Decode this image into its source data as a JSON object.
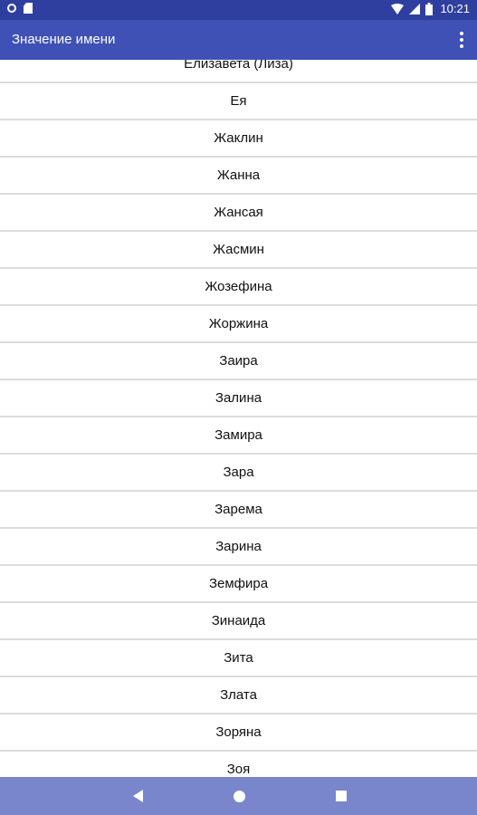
{
  "status_bar": {
    "time": "10:21",
    "icons": [
      "sync-circle-icon",
      "sd-card-icon",
      "wifi-icon",
      "signal-icon",
      "battery-icon"
    ]
  },
  "app_bar": {
    "title": "Значение имени",
    "menu_icon": "overflow-menu-icon"
  },
  "names": [
    "Елизавета (Лиза)",
    "Ея",
    "Жаклин",
    "Жанна",
    "Жансая",
    "Жасмин",
    "Жозефина",
    "Жоржина",
    "Заира",
    "Залина",
    "Замира",
    "Зара",
    "Зарема",
    "Зарина",
    "Земфира",
    "Зинаида",
    "Зита",
    "Злата",
    "Зоряна",
    "Зоя"
  ],
  "nav_bar": {
    "back_icon": "back-triangle-icon",
    "home_icon": "home-circle-icon",
    "recent_icon": "recent-apps-square-icon"
  },
  "colors": {
    "status_bar": "#2f3f9f",
    "app_bar": "#3f51b5",
    "nav_bar": "#7986cb",
    "divider": "#dcdcdc"
  }
}
